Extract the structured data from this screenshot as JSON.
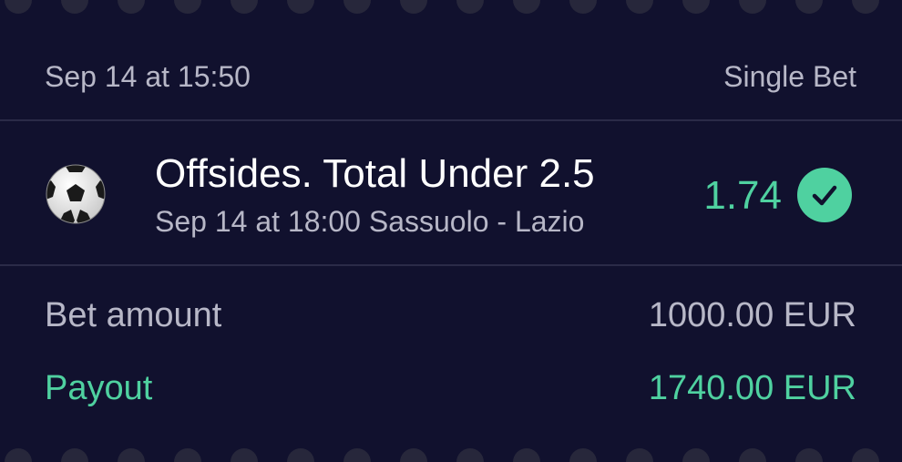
{
  "header": {
    "placed_at": "Sep 14 at 15:50",
    "bet_type": "Single Bet"
  },
  "selection": {
    "sport_icon": "soccer-ball-icon",
    "title": "Offsides. Total Under 2.5",
    "subtitle": "Sep 14 at 18:00 Sassuolo - Lazio",
    "odds": "1.74",
    "status_icon": "check-circle-icon"
  },
  "summary": {
    "amount_label": "Bet amount",
    "amount_value": "1000.00 EUR",
    "payout_label": "Payout",
    "payout_value": "1740.00 EUR"
  },
  "colors": {
    "background": "#11112e",
    "accent": "#4fd1a0",
    "muted_text": "#b7b7c7",
    "primary_text": "#ffffff"
  }
}
